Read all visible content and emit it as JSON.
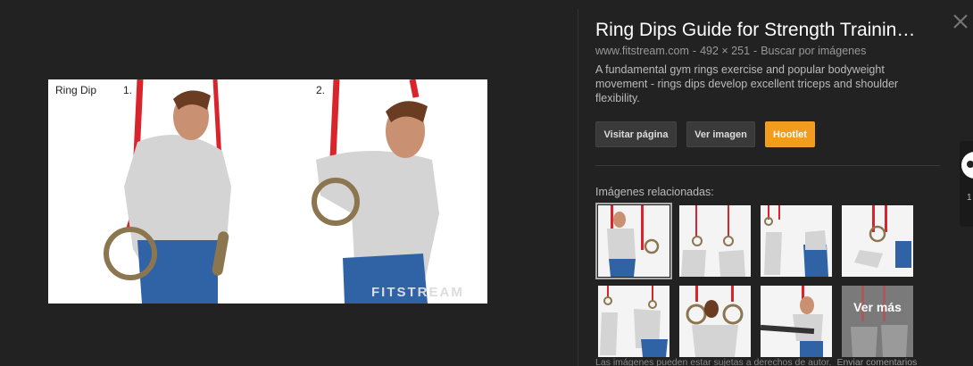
{
  "image": {
    "title": "Ring Dip",
    "step1": "1.",
    "step2": "2.",
    "watermark": "FITSTREAM"
  },
  "info": {
    "title": "Ring Dips Guide for Strength Trainin…",
    "source_domain": "www.fitstream.com",
    "dimensions": "492 × 251",
    "search_by_image": "Buscar por imágenes",
    "description": "A fundamental gym rings exercise and popular bodyweight movement - rings dips develop excellent triceps and shoulder flexibility."
  },
  "buttons": {
    "visit": "Visitar página",
    "view": "Ver imagen",
    "hootlet": "Hootlet"
  },
  "related": {
    "label": "Imágenes relacionadas:",
    "more_label": "Ver más"
  },
  "footer": {
    "notice": "Las imágenes pueden estar sujetas a derechos de autor.",
    "feedback": "Enviar comentarios"
  },
  "owl_count": "1",
  "colors": {
    "background": "#222222",
    "accent": "#f29b1d",
    "button": "#3a3a3a",
    "ring_strap": "#d9242b"
  }
}
